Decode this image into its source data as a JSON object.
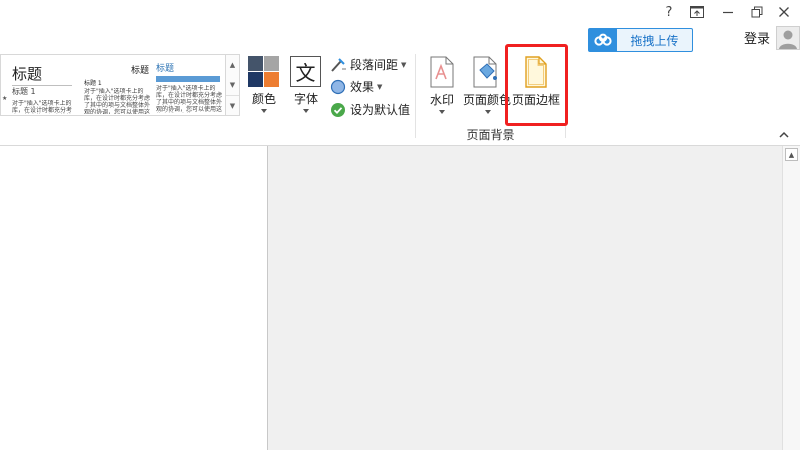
{
  "window": {
    "help_label": "?",
    "controls": [
      "help",
      "pin",
      "minimize",
      "restore",
      "close"
    ]
  },
  "upload": {
    "label": "拖拽上传",
    "icon": "cloud-icon",
    "color": "#2f8fde"
  },
  "account": {
    "login_label": "登录"
  },
  "style_gallery": {
    "items": [
      {
        "title": "标题",
        "subtitle": "标题 1",
        "text": "对于\"插入\"选项卡上的库，在设计时都充分考虑了其中的项与文档整体外观的协调"
      },
      {
        "title": "标题",
        "subtitle": "标题 1",
        "text": "对于\"插入\"选项卡上的库，在设计时都充分考虑了其中的项与文档整体外观的协调，您可以使用这些库插入表格、页眉、页脚、列表、封面以及其他文档构建基块"
      },
      {
        "title": "标题",
        "subtitle": "",
        "text": "对于\"插入\"选项卡上的库，在设计时都充分考虑了其中的项与文档整体外观的协调，您可以使用这些库插入表格、页眉、页脚、列表、封面以及其他文档构建基块"
      }
    ],
    "left_marker": "★"
  },
  "ribbon": {
    "colors_label": "颜色",
    "fonts_label": "字体",
    "fonts_glyph": "文",
    "paragraph_spacing_label": "段落间距",
    "effects_label": "效果",
    "set_default_label": "设为默认值",
    "watermark_label": "水印",
    "page_color_label": "页面颜色",
    "page_border_label": "页面边框",
    "group_label": "页面背景"
  },
  "colors": {
    "accent": "#2f8fde",
    "highlight": "#f02020",
    "theme_swatches": [
      "#44546a",
      "#a5a5a5",
      "#1f3864",
      "#ed7d31"
    ]
  }
}
